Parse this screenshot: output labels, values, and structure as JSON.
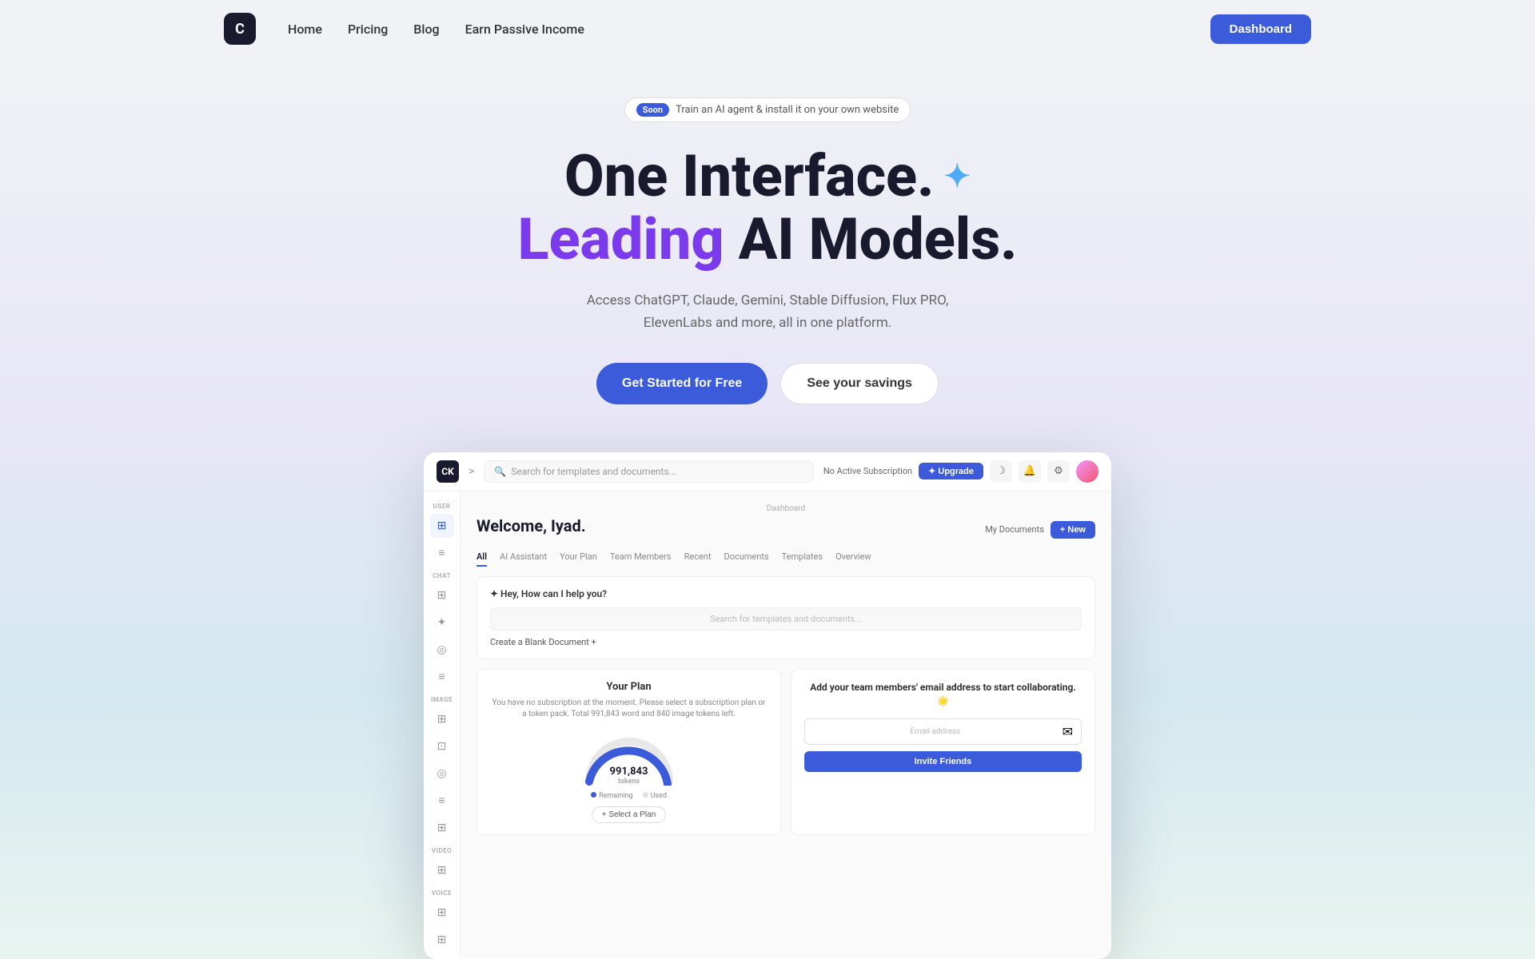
{
  "nav": {
    "logo_text": "C",
    "links": [
      {
        "label": "Home",
        "id": "home"
      },
      {
        "label": "Pricing",
        "id": "pricing"
      },
      {
        "label": "Blog",
        "id": "blog"
      },
      {
        "label": "Earn Passive Income",
        "id": "earn"
      }
    ],
    "dashboard_label": "Dashboard"
  },
  "hero": {
    "badge_soon": "Soon",
    "badge_text": "Train an AI agent & install it on your own website",
    "headline1": "One Interface.",
    "sparkle": "✦",
    "headline2_purple": "Leading",
    "headline2_dark": " AI Models.",
    "description": "Access ChatGPT, Claude, Gemini, Stable Diffusion, Flux PRO, ElevenLabs and more, all in one platform.",
    "cta_primary": "Get Started for Free",
    "cta_secondary": "See your savings"
  },
  "dashboard": {
    "topbar": {
      "logo": "CK",
      "arrow": ">",
      "search_placeholder": "Search for templates and documents...",
      "subscription_label": "No Active Subscription",
      "upgrade_label": "✦ Upgrade",
      "moon_icon": "☽",
      "bell_icon": "🔔",
      "settings_icon": "⚙"
    },
    "sidebar": {
      "sections": [
        {
          "label": "USER",
          "icons": [
            "⊞",
            "≡"
          ]
        },
        {
          "label": "CHAT",
          "icons": [
            "⊞",
            "✦",
            "◎",
            "≡"
          ]
        },
        {
          "label": "IMAGE",
          "icons": [
            "⊞",
            "⊡",
            "◎",
            "≡",
            "⊞"
          ]
        },
        {
          "label": "VIDEO",
          "icons": [
            "⊞"
          ]
        },
        {
          "label": "VOICE",
          "icons": [
            "⊞",
            "⊞"
          ]
        }
      ]
    },
    "main": {
      "breadcrumb": "Dashboard",
      "welcome": "Welcome, Iyad.",
      "my_docs": "My Documents",
      "new_btn": "+ New",
      "tabs": [
        "All",
        "AI Assistant",
        "Your Plan",
        "Team Members",
        "Recent",
        "Documents",
        "Templates",
        "Overview"
      ],
      "ai_card": {
        "header": "✦ Hey, How can I help you?",
        "search_placeholder": "Search for templates and documents...",
        "blank_doc": "Create a Blank Document  +"
      },
      "plan_card": {
        "title": "Your Plan",
        "desc": "You have no subscription at the moment. Please select a subscription plan or a token pack. Total 991,843 word and 840 image tokens left.",
        "tokens": "991,843",
        "tokens_sub": "tokens",
        "legend_remaining": "Remaining",
        "legend_used": "Used",
        "select_plan": "+ Select a Plan"
      },
      "team_card": {
        "title": "Add your team members' email address to start collaborating. 🌟",
        "email_placeholder": "Email address",
        "invite_label": "Invite Friends"
      }
    }
  }
}
